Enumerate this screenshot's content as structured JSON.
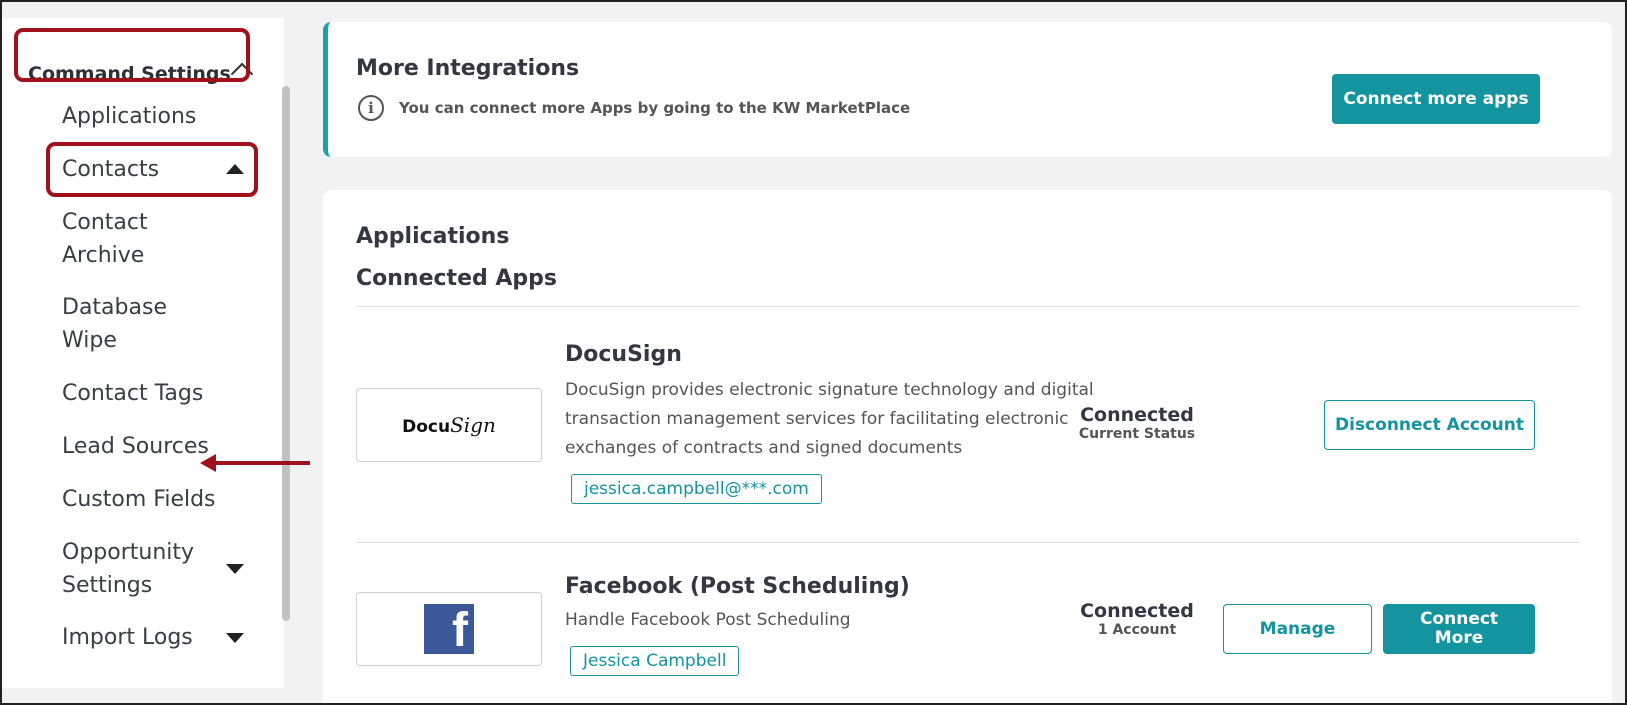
{
  "sidebar": {
    "header": "Command Settings",
    "items": [
      {
        "label": "Applications"
      },
      {
        "label": "Contacts"
      },
      {
        "label": "Contact",
        "label2": "Archive"
      },
      {
        "label": "Database",
        "label2": "Wipe"
      },
      {
        "label": "Contact Tags"
      },
      {
        "label": "Lead Sources"
      },
      {
        "label": "Custom Fields"
      },
      {
        "label": "Opportunity",
        "label2": "Settings"
      },
      {
        "label": "Import Logs"
      }
    ]
  },
  "integrations": {
    "title": "More Integrations",
    "info_icon": "info-icon",
    "info_text": "You can connect more Apps by going to the KW MarketPlace",
    "button": "Connect more apps"
  },
  "applications": {
    "title": "Applications",
    "subtitle": "Connected Apps",
    "apps": [
      {
        "name": "DocuSign",
        "logo_text": "Docu",
        "logo_script": "Sign",
        "desc_lines": [
          "DocuSign provides electronic signature technology and digital",
          "transaction management services for facilitating electronic",
          "exchanges of contracts and signed documents"
        ],
        "tag": "jessica.campbell@***.com",
        "status": "Connected",
        "status_sub": "Current Status",
        "button": "Disconnect Account"
      },
      {
        "name": "Facebook (Post Scheduling)",
        "logo_text": "f",
        "desc_lines": [
          "Handle Facebook Post Scheduling"
        ],
        "tag": "Jessica Campbell",
        "status": "Connected",
        "status_sub": "1 Account",
        "button_manage": "Manage",
        "button_connect_1": "Connect",
        "button_connect_2": "More"
      }
    ]
  },
  "colors": {
    "accent": "#13949e",
    "highlight": "#a1111c"
  }
}
